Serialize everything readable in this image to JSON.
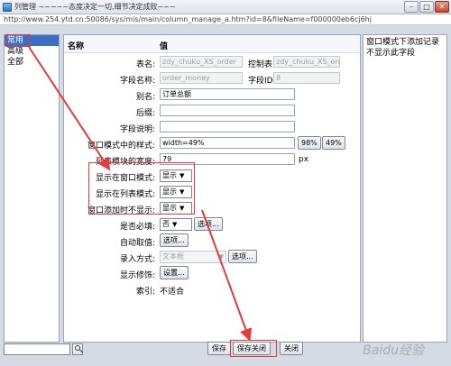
{
  "window": {
    "title": "列管理 ~~~~~态度决定一切,细节决定成败~~~",
    "url": "http://www.254.ytd.cn:50086/sys/mis/main/column_manage_a.htm?id=8&fileName=f000000eb6cj6hj"
  },
  "categories": [
    "常用",
    "高级",
    "全部"
  ],
  "header": {
    "name": "名称",
    "value": "值"
  },
  "fields": {
    "table_name": {
      "label": "表名:",
      "value": "zdy_chuku_XS_order"
    },
    "control_table": {
      "label": "控制表",
      "value": "zdy_chuku_XS_order"
    },
    "field_name": {
      "label": "字段名称:",
      "value": "order_money"
    },
    "field_id": {
      "label": "字段ID",
      "value": "8"
    },
    "alias": {
      "label": "别名:",
      "value": "订单总额"
    },
    "suffix": {
      "label": "后缀:",
      "value": ""
    },
    "description": {
      "label": "字段说明:",
      "value": ""
    },
    "window_style": {
      "label": "窗口模式中的样式:",
      "value": "width=49%",
      "btn1": "98%",
      "btn2": "49%"
    },
    "list_width": {
      "label": "列表模块的宽度:",
      "value": "79",
      "unit": "px"
    },
    "show_window": {
      "label": "显示在窗口模式:",
      "value": "显示"
    },
    "show_list": {
      "label": "显示在列表模式:",
      "value": "显示"
    },
    "add_hide": {
      "label": "窗口添加时不显示:",
      "value": "显示"
    },
    "required": {
      "label": "是否必填:",
      "value": "否",
      "btn": "选项..."
    },
    "auto_value": {
      "label": "自动取值:",
      "btn": "选项..."
    },
    "input_method": {
      "label": "录入方式:",
      "value": "文本框",
      "btn": "选项..."
    },
    "display_decor": {
      "label": "显示修饰:",
      "btn": "设置..."
    },
    "index": {
      "label": "索引:",
      "value": "不适合"
    }
  },
  "hint": "窗口模式下添加记录不显示此字段",
  "footer": {
    "save": "保存",
    "save_close": "保存关闭",
    "close": "关闭"
  },
  "watermark": "Baidu经验"
}
